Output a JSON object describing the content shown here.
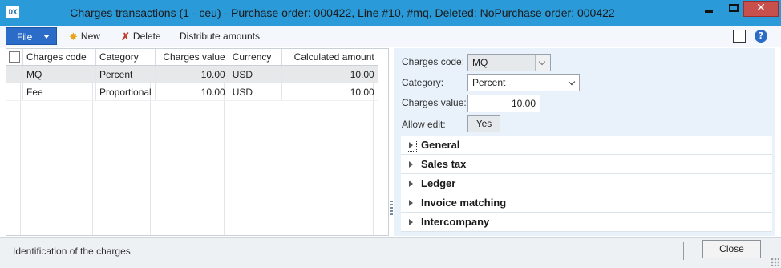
{
  "window": {
    "title": "Charges transactions (1 - ceu) - Purchase order: 000422, Line #10, #mq, Deleted: NoPurchase order: 000422",
    "app_icon_text": "DX",
    "close_glyph": "✕"
  },
  "toolbar": {
    "file_label": "File",
    "new_label": "New",
    "delete_label": "Delete",
    "distribute_label": "Distribute amounts",
    "help_glyph": "?"
  },
  "grid": {
    "columns": [
      "Charges code",
      "Category",
      "Charges value",
      "Currency",
      "Calculated amount"
    ],
    "rows": [
      {
        "code": "MQ",
        "category": "Percent",
        "value": "10.00",
        "currency": "USD",
        "amount": "10.00",
        "selected": true
      },
      {
        "code": "Fee",
        "category": "Proportional",
        "value": "10.00",
        "currency": "USD",
        "amount": "10.00",
        "selected": false
      }
    ]
  },
  "details": {
    "charges_code_label": "Charges code:",
    "charges_code_value": "MQ",
    "category_label": "Category:",
    "category_value": "Percent",
    "charges_value_label": "Charges value:",
    "charges_value_value": "10.00",
    "allow_edit_label": "Allow edit:",
    "allow_edit_value": "Yes"
  },
  "fasttabs": [
    "General",
    "Sales tax",
    "Ledger",
    "Invoice matching",
    "Intercompany"
  ],
  "status": {
    "text": "Identification of the charges",
    "close_label": "Close"
  },
  "colors": {
    "titlebar": "#2b9ad8",
    "file_button": "#2a6cc8",
    "window_close": "#c7504c",
    "details_panel": "#e9f2fb"
  }
}
